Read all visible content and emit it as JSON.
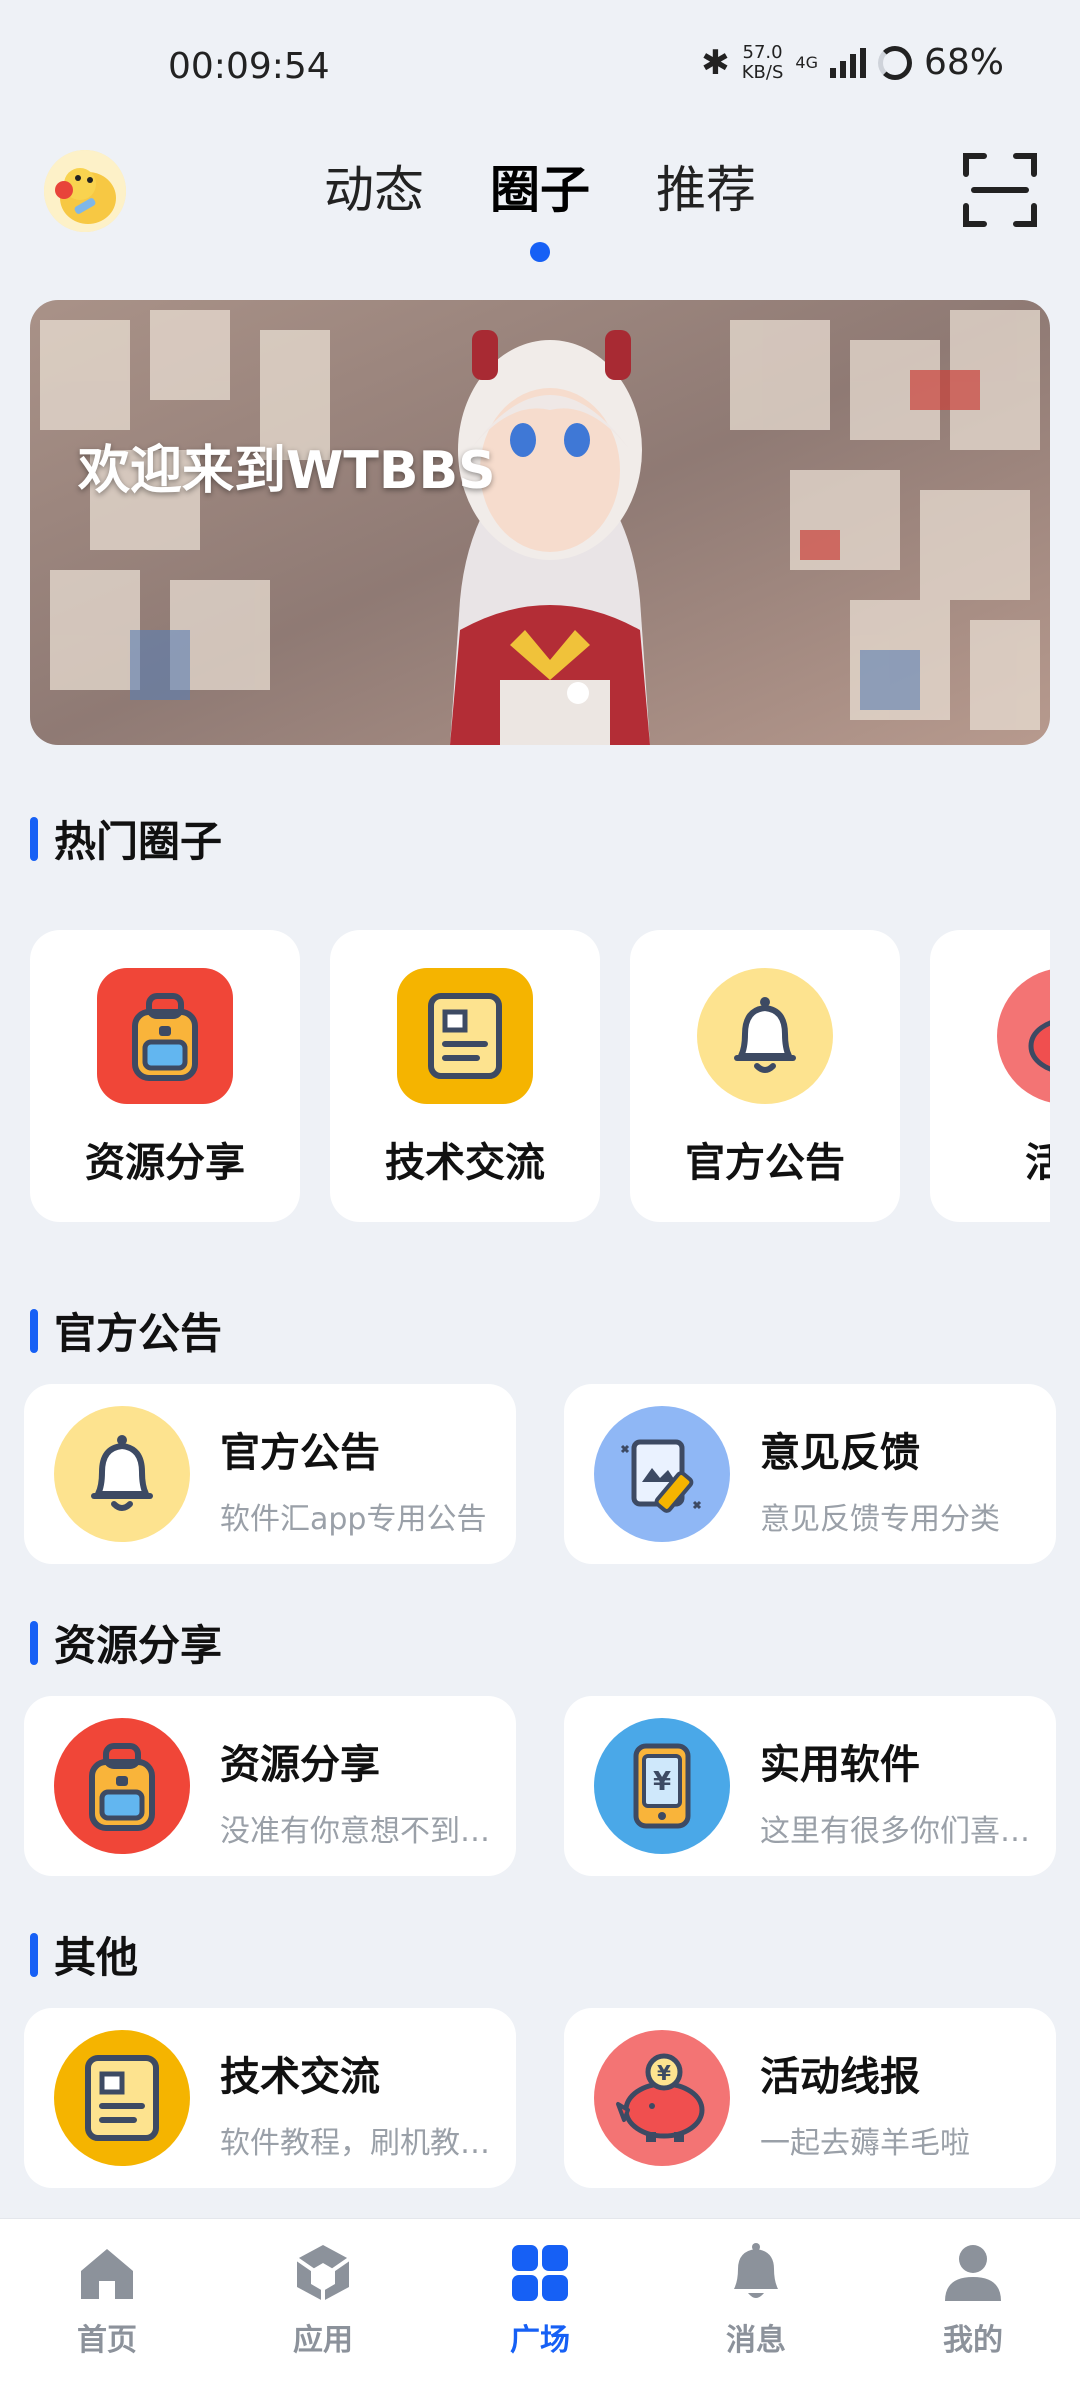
{
  "status_bar": {
    "time": "00:09:54",
    "speed_value": "57.0",
    "speed_unit": "KB/S",
    "network": "4G",
    "battery": "68%"
  },
  "header": {
    "tabs": [
      {
        "label": "动态",
        "active": false
      },
      {
        "label": "圈子",
        "active": true
      },
      {
        "label": "推荐",
        "active": false
      }
    ],
    "avatar_icon": "duck-avatar-icon",
    "scan_icon": "scan-icon"
  },
  "banner": {
    "title": "欢迎来到WTBBS",
    "pages": 1,
    "current_page": 1
  },
  "sections": {
    "hot": {
      "title": "热门圈子"
    },
    "official": {
      "title": "官方公告"
    },
    "resources": {
      "title": "资源分享"
    },
    "other": {
      "title": "其他"
    }
  },
  "hot_circles": [
    {
      "label": "资源分享",
      "icon": "backpack-icon",
      "color": "#f04638"
    },
    {
      "label": "技术交流",
      "icon": "document-icon",
      "color": "#f5b400"
    },
    {
      "label": "官方公告",
      "icon": "bell-icon",
      "color": "#fde38f"
    },
    {
      "label": "活动",
      "icon": "piggy-bank-icon",
      "color": "#f37474"
    }
  ],
  "official_list": [
    {
      "name": "官方公告",
      "desc": "软件汇app专用公告",
      "icon": "bell-icon"
    },
    {
      "name": "意见反馈",
      "desc": "意见反馈专用分类",
      "icon": "feedback-icon"
    }
  ],
  "resource_list": [
    {
      "name": "资源分享",
      "desc": "没准有你意想不到的资源",
      "icon": "backpack-icon"
    },
    {
      "name": "实用软件",
      "desc": "这里有很多你们喜欢的软件",
      "icon": "phone-yuan-icon"
    }
  ],
  "other_list": [
    {
      "name": "技术交流",
      "desc": "软件教程，刷机教程分享",
      "icon": "document-icon"
    },
    {
      "name": "活动线报",
      "desc": "一起去薅羊毛啦",
      "icon": "piggy-bank-icon"
    }
  ],
  "bottom_nav": [
    {
      "label": "首页",
      "icon": "home-icon",
      "active": false
    },
    {
      "label": "应用",
      "icon": "cube-icon",
      "active": false
    },
    {
      "label": "广场",
      "icon": "grid-icon",
      "active": true
    },
    {
      "label": "消息",
      "icon": "bell-icon",
      "active": false
    },
    {
      "label": "我的",
      "icon": "person-icon",
      "active": false
    }
  ],
  "colors": {
    "accent": "#1660f5",
    "page_bg": "#eef1f6",
    "muted_text": "#9aa0a8"
  }
}
